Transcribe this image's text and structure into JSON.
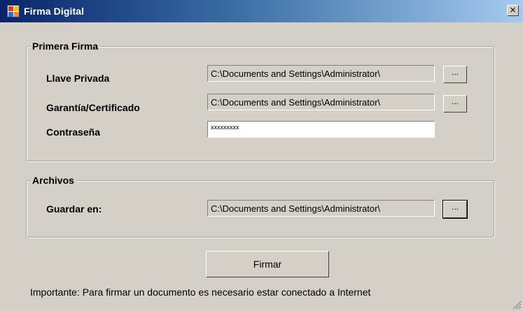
{
  "window": {
    "title": "Firma Digital",
    "close_glyph": "×",
    "icon": "app-icon"
  },
  "primera_firma": {
    "group_label": "Primera Firma",
    "llave_privada": {
      "label": "Llave Privada",
      "value": "C:\\Documents and Settings\\Administrator\\",
      "browse_label": "..."
    },
    "garantia": {
      "label": "Garantía/Certificado",
      "value": "C:\\Documents and Settings\\Administrator\\",
      "browse_label": "..."
    },
    "contrasena": {
      "label": "Contraseña",
      "value": "xxxxxxxxx"
    }
  },
  "archivos": {
    "group_label": "Archivos",
    "guardar_en": {
      "label": "Guardar en:",
      "value": "C:\\Documents and Settings\\Administrator\\",
      "browse_label": "..."
    }
  },
  "actions": {
    "firmar_label": "Firmar"
  },
  "note": "Importante: Para firmar un documento es necesario estar conectado a Internet",
  "colors": {
    "window_bg": "#d4d0c8",
    "titlebar_start": "#0a246a",
    "titlebar_end": "#a6caf0"
  }
}
